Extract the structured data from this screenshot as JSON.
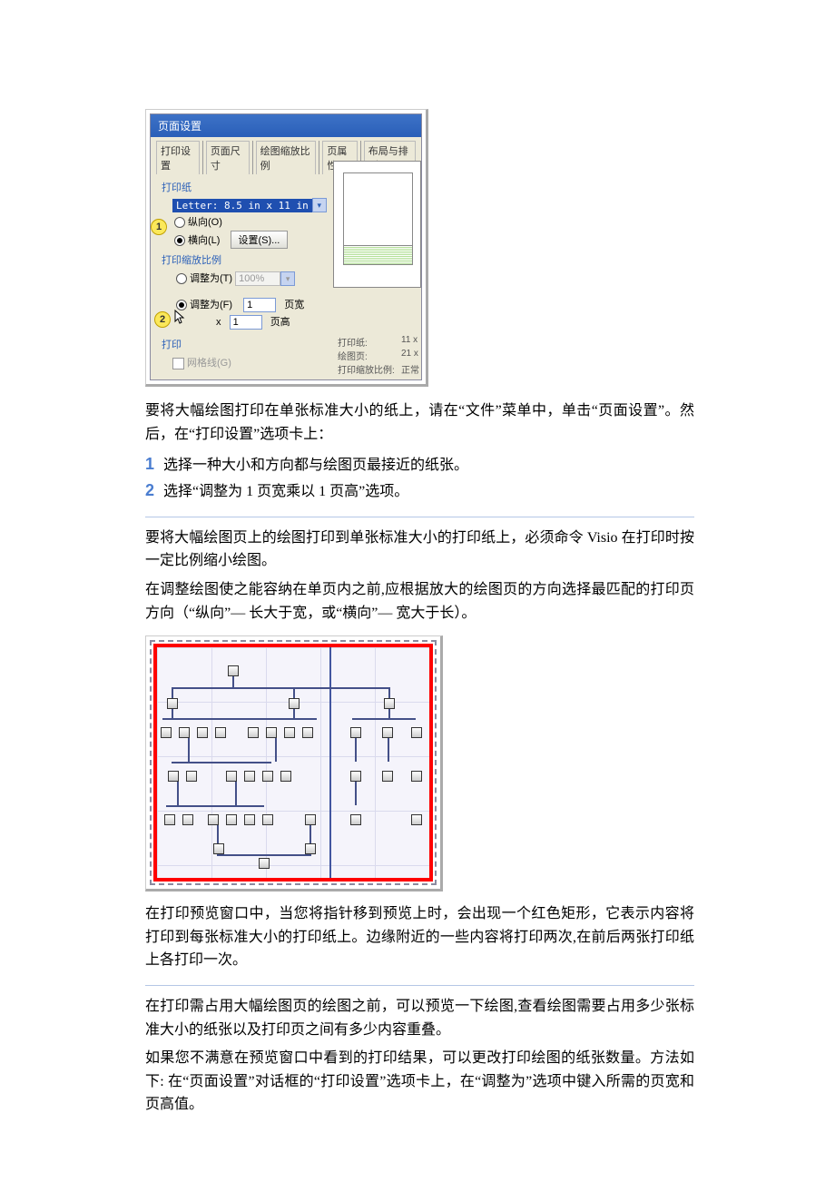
{
  "dialog": {
    "title": "页面设置",
    "tabs": [
      "打印设置",
      "页面尺寸",
      "绘图缩放比例",
      "页属性",
      "布局与排列"
    ],
    "paper_group": "打印纸",
    "paper_size": "Letter:  8.5 in x 11 in",
    "orient_portrait": "纵向(O)",
    "orient_landscape": "横向(L)",
    "setup_button": "设置(S)...",
    "zoom_group": "打印缩放比例",
    "adjust_to": "调整为(T)",
    "adjust_pct": "100%",
    "fit_to": "调整为(F)",
    "fit_width_val": "1",
    "fit_width_label": "页宽",
    "fit_x": "x",
    "fit_height_val": "1",
    "fit_height_label": "页高",
    "print_group": "打印",
    "gridlines": "网格线(G)",
    "info_paper_label": "打印纸:",
    "info_paper_val": "11 x",
    "info_drawing_label": "绘图页:",
    "info_drawing_val": "21 x",
    "info_zoom_label": "打印缩放比例:",
    "info_zoom_val": "正常"
  },
  "callouts": {
    "one": "1",
    "two": "2"
  },
  "para1": "要将大幅绘图打印在单张标准大小的纸上，请在“文件”菜单中，单击“页面设置”。然后，在“打印设置”选项卡上：",
  "step1": "选择一种大小和方向都与绘图页最接近的纸张。",
  "step2": "选择“调整为 1 页宽乘以 1 页高”选项。",
  "para2a": "要将大幅绘图页上的绘图打印到单张标准大小的打印纸上，必须命令 Visio 在打印时按一定比例缩小绘图。",
  "para2b": "在调整绘图使之能容纳在单页内之前,应根据放大的绘图页的方向选择最匹配的打印页方向（“纵向”— 长大于宽，或“横向”— 宽大于长）。",
  "para3": "在打印预览窗口中，当您将指针移到预览上时，会出现一个红色矩形，它表示内容将打印到每张标准大小的打印纸上。边缘附近的一些内容将打印两次,在前后两张打印纸上各打印一次。",
  "para4a": "在打印需占用大幅绘图页的绘图之前，可以预览一下绘图,查看绘图需要占用多少张标准大小的纸张以及打印页之间有多少内容重叠。",
  "para4b": "如果您不满意在预览窗口中看到的打印结果，可以更改打印绘图的纸张数量。方法如下: 在“页面设置”对话框的“打印设置”选项卡上，在“调整为”选项中键入所需的页宽和页高值。"
}
